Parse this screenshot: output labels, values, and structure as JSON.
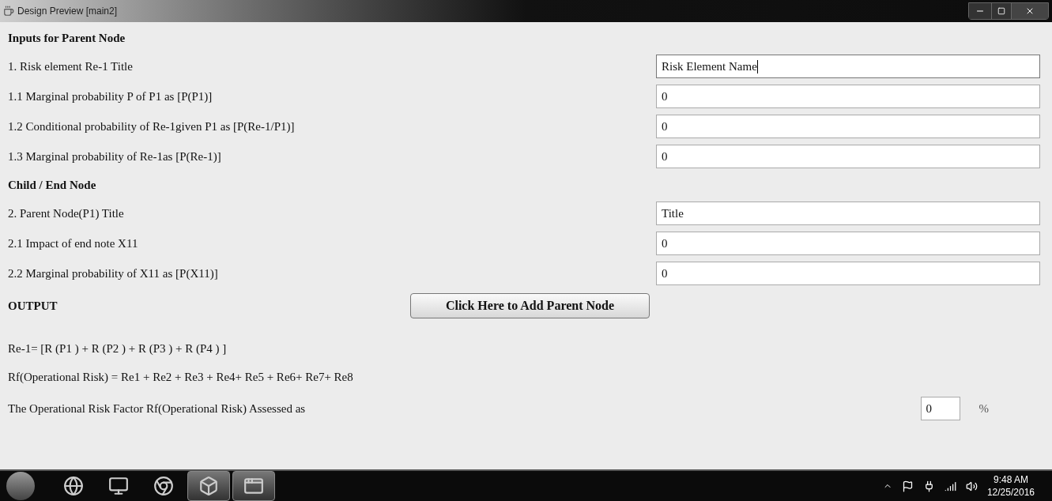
{
  "window": {
    "title": "Design Preview [main2]"
  },
  "sections": [
    {
      "heading": "Inputs for Parent Node",
      "rows": [
        {
          "label": "1. Risk element Re-1 Title",
          "value": "Risk Element Name",
          "focused": true
        },
        {
          "label": "1.1  Marginal probability P of P1 as [P(P1)]",
          "value": "0",
          "focused": false
        },
        {
          "label": "1.2 Conditional probability of Re-1given P1 as [P(Re-1/P1)]",
          "value": "0",
          "focused": false
        },
        {
          "label": "1.3 Marginal probability of Re-1as [P(Re-1)]",
          "value": "0",
          "focused": false
        }
      ]
    },
    {
      "heading": "Child / End Node",
      "rows": [
        {
          "label": "2. Parent Node(P1) Title",
          "value": "Title",
          "focused": false
        },
        {
          "label": "2.1 Impact of end note X11",
          "value": "0",
          "focused": false
        },
        {
          "label": "2.2 Marginal probability of X11 as [P(X11)]",
          "value": "0",
          "focused": false
        }
      ]
    }
  ],
  "output": {
    "heading": "OUTPUT",
    "button": "Click Here to Add Parent Node",
    "formulas": [
      "Re-1= [R (P1 ) + R (P2 )  + R (P3 )  + R (P4 )  ]",
      "Rf(Operational Risk) = Re1 + Re2 + Re3 + Re4+ Re5 + Re6+ Re7+ Re8"
    ],
    "result_label": "The Operational Risk Factor Rf(Operational Risk)  Assessed as",
    "result_value": "0",
    "result_unit": "%"
  },
  "taskbar": {
    "apps": [
      {
        "kind": "browser",
        "active": false
      },
      {
        "kind": "monitor",
        "active": false
      },
      {
        "kind": "chrome",
        "active": false
      },
      {
        "kind": "cube",
        "active": true
      },
      {
        "kind": "window",
        "active": true
      }
    ],
    "time": "9:48 AM",
    "date": "12/25/2016"
  }
}
